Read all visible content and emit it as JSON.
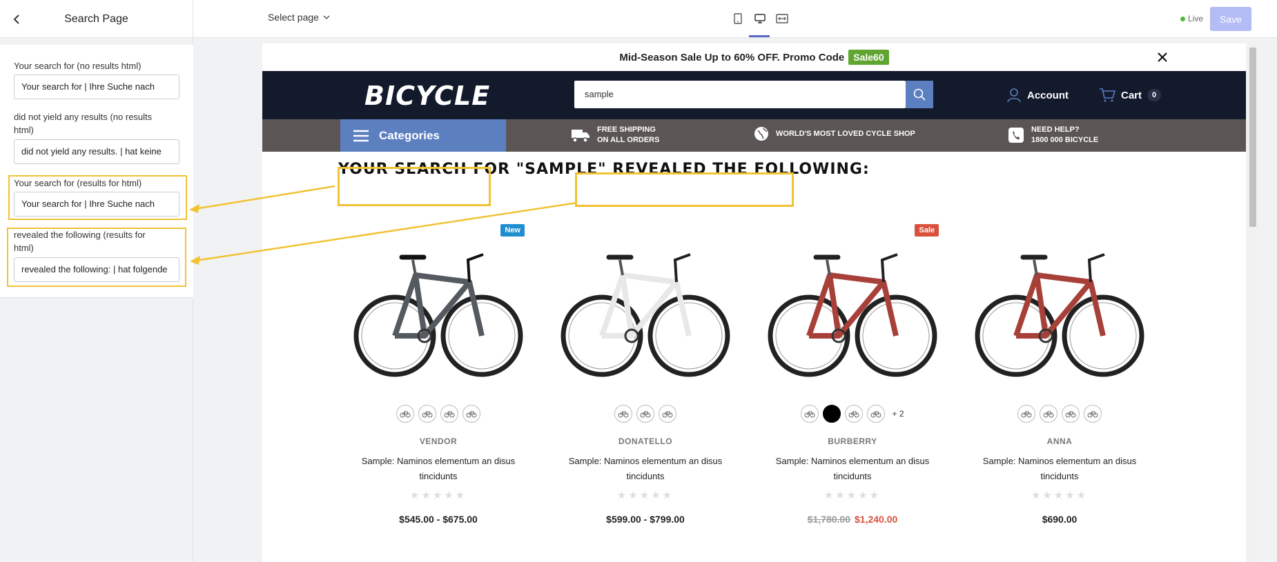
{
  "editor": {
    "title": "Search Page",
    "select_page": "Select page",
    "live_label": "Live",
    "save_label": "Save",
    "colors": {
      "accent": "#5c6ac4",
      "live": "#50b83c",
      "highlight": "#f1c232"
    }
  },
  "settings": [
    {
      "label": "Your search for (no results html)",
      "value": "Your search for | Ihre Suche nach"
    },
    {
      "label": "did not yield any results (no results html)",
      "value": "did not yield any results. | hat keine"
    },
    {
      "label": "Your search for (results for html)",
      "value": "Your search for | Ihre Suche nach"
    },
    {
      "label": "revealed the following (results for html)",
      "value": "revealed the following: | hat folgende"
    }
  ],
  "store": {
    "promo_text": "Mid-Season Sale Up to 60% OFF. Promo Code",
    "promo_code": "Sale60",
    "logo": "BICYCLE",
    "search_value": "sample",
    "account_label": "Account",
    "cart_label": "Cart",
    "cart_count": "0",
    "categories_label": "Categories",
    "features": [
      {
        "icon": "truck-icon",
        "line1": "FREE SHIPPING",
        "line2": "ON ALL ORDERS"
      },
      {
        "icon": "globe-icon",
        "line1": "WORLD'S MOST LOVED CYCLE SHOP",
        "line2": ""
      },
      {
        "icon": "phone-icon",
        "line1": "NEED HELP?",
        "line2": "1800 000 BICYCLE"
      }
    ],
    "heading": {
      "part1": "YOUR SEARCH FOR",
      "query": "\"SAMPLE\"",
      "part2": "REVEALED THE FOLLOWING:"
    },
    "products": [
      {
        "badge": "New",
        "badge_color": "#1f8ecf",
        "vendor": "VENDOR",
        "title": "Sample: Naminos elementum an disus tincidunts",
        "price": "$545.00 - $675.00",
        "old_price": "",
        "frame_color": "#555a60",
        "more": ""
      },
      {
        "badge": "",
        "badge_color": "",
        "vendor": "DONATELLO",
        "title": "Sample: Naminos elementum an disus tincidunts",
        "price": "$599.00 - $799.00",
        "old_price": "",
        "frame_color": "#e8e8e8",
        "more": ""
      },
      {
        "badge": "Sale",
        "badge_color": "#d9513c",
        "vendor": "BURBERRY",
        "title": "Sample: Naminos elementum an disus tincidunts",
        "price": "$1,240.00",
        "old_price": "$1,780.00",
        "frame_color": "#a8403a",
        "more": "+ 2"
      },
      {
        "badge": "",
        "badge_color": "",
        "vendor": "ANNA",
        "title": "Sample: Naminos elementum an disus tincidunts",
        "price": "$690.00",
        "old_price": "",
        "frame_color": "#a8403a",
        "more": ""
      }
    ]
  }
}
